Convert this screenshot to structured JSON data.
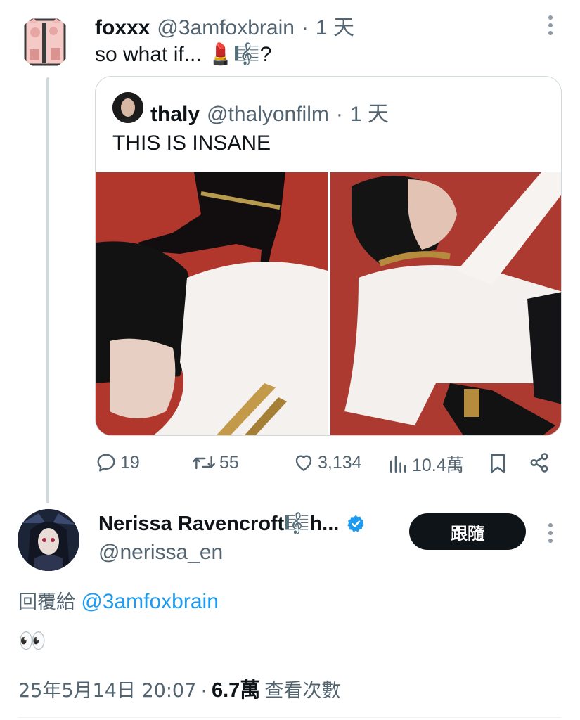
{
  "post1": {
    "display_name": "foxxx",
    "handle": "@3amfoxbrain",
    "time": "1 天",
    "text": "so what if... ",
    "emoji": "💄🎼?",
    "metrics": {
      "replies": "19",
      "reposts": "55",
      "likes": "3,134",
      "views": "10.4萬"
    }
  },
  "quote": {
    "display_name": "thaly",
    "handle": "@thalyonfilm",
    "time": "1 天",
    "text": "THIS IS INSANE"
  },
  "post2": {
    "display_name": "Nerissa Ravencroft🎼h...",
    "handle": "@nerissa_en",
    "follow_label": "跟隨",
    "reply_prefix": "回覆給",
    "reply_to": "@3amfoxbrain",
    "text": "👀",
    "date": "25年5月14日 20:07",
    "views_count": "6.7萬",
    "views_label": "查看次數"
  },
  "colors": {
    "link": "#1d9bf0",
    "muted": "#536471",
    "verified": "#1d9bf0",
    "photo_bg": "#b0362c"
  }
}
